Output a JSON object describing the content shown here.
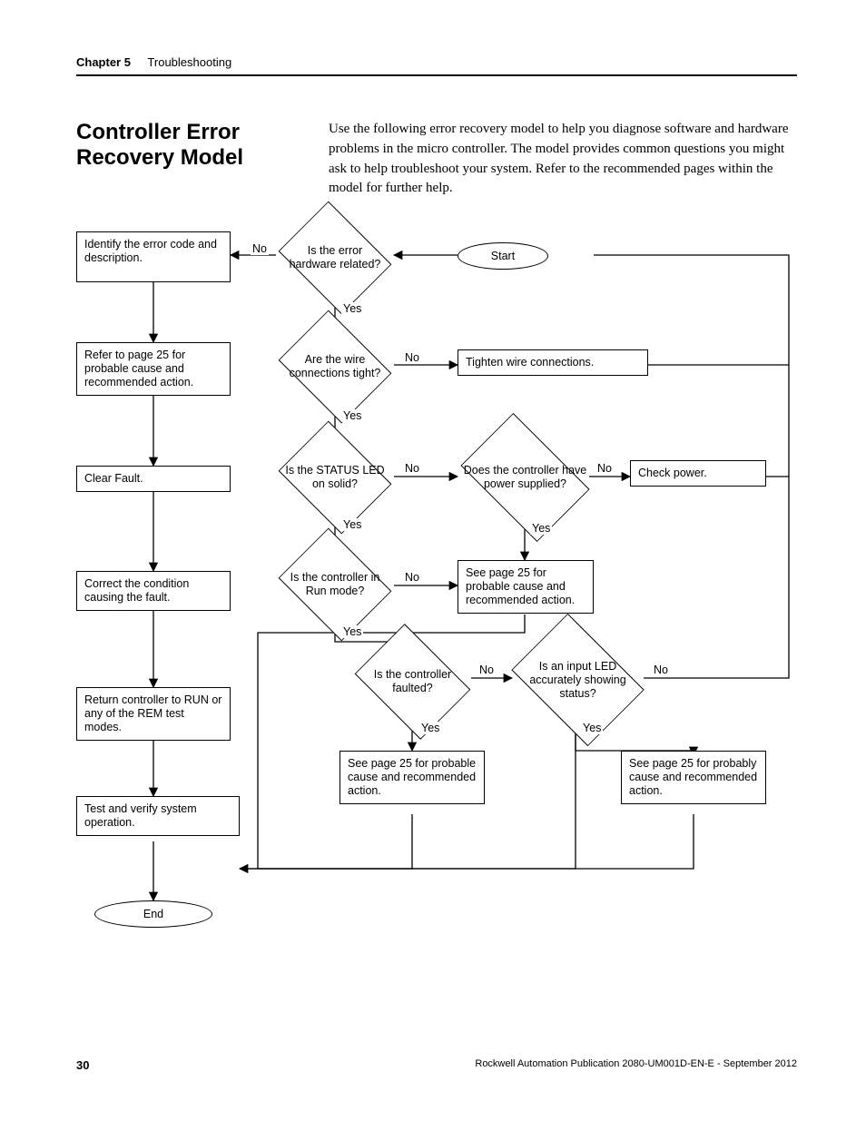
{
  "header": {
    "chapter": "Chapter 5",
    "title": "Troubleshooting"
  },
  "section": {
    "title": "Controller Error Recovery Model",
    "body": "Use the following error recovery model to help you diagnose software and hardware problems in the micro controller. The model provides common questions you might ask to help troubleshoot your system. Refer to the recommended pages within the model for further help."
  },
  "chart_data": {
    "type": "flowchart",
    "terminators": {
      "start": "Start",
      "end": "End"
    },
    "decisions": {
      "d_err_hw": "Is the error hardware related?",
      "d_wire": "Are the wire connections tight?",
      "d_status_led": "Is the STATUS LED on solid?",
      "d_power": "Does the controller have power supplied?",
      "d_run": "Is the controller in Run mode?",
      "d_faulted": "Is the controller faulted?",
      "d_input_led": "Is an input LED accurately showing status?"
    },
    "processes": {
      "p_identify": "Identify the error code and description.",
      "p_refer25": "Refer to page 25 for probable cause and recommended action.",
      "p_clear": "Clear Fault.",
      "p_correct": "Correct the condition causing the fault.",
      "p_return": "Return controller to RUN or any of the REM test modes.",
      "p_test": "Test and verify system operation.",
      "p_tighten": "Tighten wire connections.",
      "p_checkpower": "Check power.",
      "p_see25a": "See page 25 for probable cause and recommended action.",
      "p_see25b": "See page 25 for probable cause and recommended action.",
      "p_see25c": "See page 25 for probably cause and recommended action."
    },
    "labels": {
      "yes": "Yes",
      "no": "No"
    }
  },
  "footer": {
    "page": "30",
    "pub": "Rockwell Automation Publication 2080-UM001D-EN-E - September 2012"
  }
}
